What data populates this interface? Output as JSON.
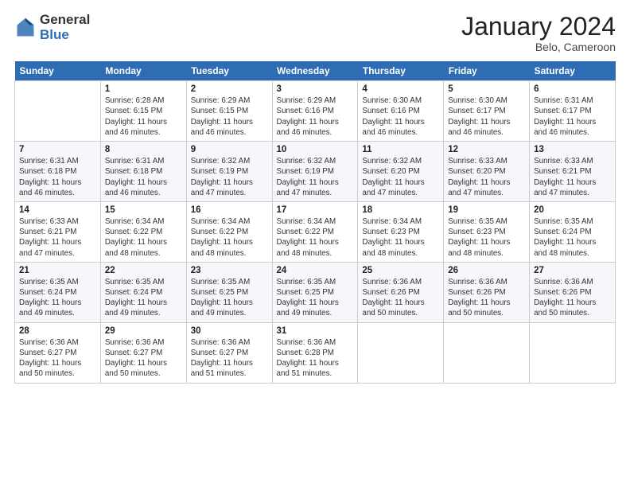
{
  "header": {
    "logo_general": "General",
    "logo_blue": "Blue",
    "month_title": "January 2024",
    "location": "Belo, Cameroon"
  },
  "days_of_week": [
    "Sunday",
    "Monday",
    "Tuesday",
    "Wednesday",
    "Thursday",
    "Friday",
    "Saturday"
  ],
  "weeks": [
    [
      {
        "day": "",
        "info": ""
      },
      {
        "day": "1",
        "info": "Sunrise: 6:28 AM\nSunset: 6:15 PM\nDaylight: 11 hours\nand 46 minutes."
      },
      {
        "day": "2",
        "info": "Sunrise: 6:29 AM\nSunset: 6:15 PM\nDaylight: 11 hours\nand 46 minutes."
      },
      {
        "day": "3",
        "info": "Sunrise: 6:29 AM\nSunset: 6:16 PM\nDaylight: 11 hours\nand 46 minutes."
      },
      {
        "day": "4",
        "info": "Sunrise: 6:30 AM\nSunset: 6:16 PM\nDaylight: 11 hours\nand 46 minutes."
      },
      {
        "day": "5",
        "info": "Sunrise: 6:30 AM\nSunset: 6:17 PM\nDaylight: 11 hours\nand 46 minutes."
      },
      {
        "day": "6",
        "info": "Sunrise: 6:31 AM\nSunset: 6:17 PM\nDaylight: 11 hours\nand 46 minutes."
      }
    ],
    [
      {
        "day": "7",
        "info": "Sunrise: 6:31 AM\nSunset: 6:18 PM\nDaylight: 11 hours\nand 46 minutes."
      },
      {
        "day": "8",
        "info": "Sunrise: 6:31 AM\nSunset: 6:18 PM\nDaylight: 11 hours\nand 46 minutes."
      },
      {
        "day": "9",
        "info": "Sunrise: 6:32 AM\nSunset: 6:19 PM\nDaylight: 11 hours\nand 47 minutes."
      },
      {
        "day": "10",
        "info": "Sunrise: 6:32 AM\nSunset: 6:19 PM\nDaylight: 11 hours\nand 47 minutes."
      },
      {
        "day": "11",
        "info": "Sunrise: 6:32 AM\nSunset: 6:20 PM\nDaylight: 11 hours\nand 47 minutes."
      },
      {
        "day": "12",
        "info": "Sunrise: 6:33 AM\nSunset: 6:20 PM\nDaylight: 11 hours\nand 47 minutes."
      },
      {
        "day": "13",
        "info": "Sunrise: 6:33 AM\nSunset: 6:21 PM\nDaylight: 11 hours\nand 47 minutes."
      }
    ],
    [
      {
        "day": "14",
        "info": "Sunrise: 6:33 AM\nSunset: 6:21 PM\nDaylight: 11 hours\nand 47 minutes."
      },
      {
        "day": "15",
        "info": "Sunrise: 6:34 AM\nSunset: 6:22 PM\nDaylight: 11 hours\nand 48 minutes."
      },
      {
        "day": "16",
        "info": "Sunrise: 6:34 AM\nSunset: 6:22 PM\nDaylight: 11 hours\nand 48 minutes."
      },
      {
        "day": "17",
        "info": "Sunrise: 6:34 AM\nSunset: 6:22 PM\nDaylight: 11 hours\nand 48 minutes."
      },
      {
        "day": "18",
        "info": "Sunrise: 6:34 AM\nSunset: 6:23 PM\nDaylight: 11 hours\nand 48 minutes."
      },
      {
        "day": "19",
        "info": "Sunrise: 6:35 AM\nSunset: 6:23 PM\nDaylight: 11 hours\nand 48 minutes."
      },
      {
        "day": "20",
        "info": "Sunrise: 6:35 AM\nSunset: 6:24 PM\nDaylight: 11 hours\nand 48 minutes."
      }
    ],
    [
      {
        "day": "21",
        "info": "Sunrise: 6:35 AM\nSunset: 6:24 PM\nDaylight: 11 hours\nand 49 minutes."
      },
      {
        "day": "22",
        "info": "Sunrise: 6:35 AM\nSunset: 6:24 PM\nDaylight: 11 hours\nand 49 minutes."
      },
      {
        "day": "23",
        "info": "Sunrise: 6:35 AM\nSunset: 6:25 PM\nDaylight: 11 hours\nand 49 minutes."
      },
      {
        "day": "24",
        "info": "Sunrise: 6:35 AM\nSunset: 6:25 PM\nDaylight: 11 hours\nand 49 minutes."
      },
      {
        "day": "25",
        "info": "Sunrise: 6:36 AM\nSunset: 6:26 PM\nDaylight: 11 hours\nand 50 minutes."
      },
      {
        "day": "26",
        "info": "Sunrise: 6:36 AM\nSunset: 6:26 PM\nDaylight: 11 hours\nand 50 minutes."
      },
      {
        "day": "27",
        "info": "Sunrise: 6:36 AM\nSunset: 6:26 PM\nDaylight: 11 hours\nand 50 minutes."
      }
    ],
    [
      {
        "day": "28",
        "info": "Sunrise: 6:36 AM\nSunset: 6:27 PM\nDaylight: 11 hours\nand 50 minutes."
      },
      {
        "day": "29",
        "info": "Sunrise: 6:36 AM\nSunset: 6:27 PM\nDaylight: 11 hours\nand 50 minutes."
      },
      {
        "day": "30",
        "info": "Sunrise: 6:36 AM\nSunset: 6:27 PM\nDaylight: 11 hours\nand 51 minutes."
      },
      {
        "day": "31",
        "info": "Sunrise: 6:36 AM\nSunset: 6:28 PM\nDaylight: 11 hours\nand 51 minutes."
      },
      {
        "day": "",
        "info": ""
      },
      {
        "day": "",
        "info": ""
      },
      {
        "day": "",
        "info": ""
      }
    ]
  ]
}
